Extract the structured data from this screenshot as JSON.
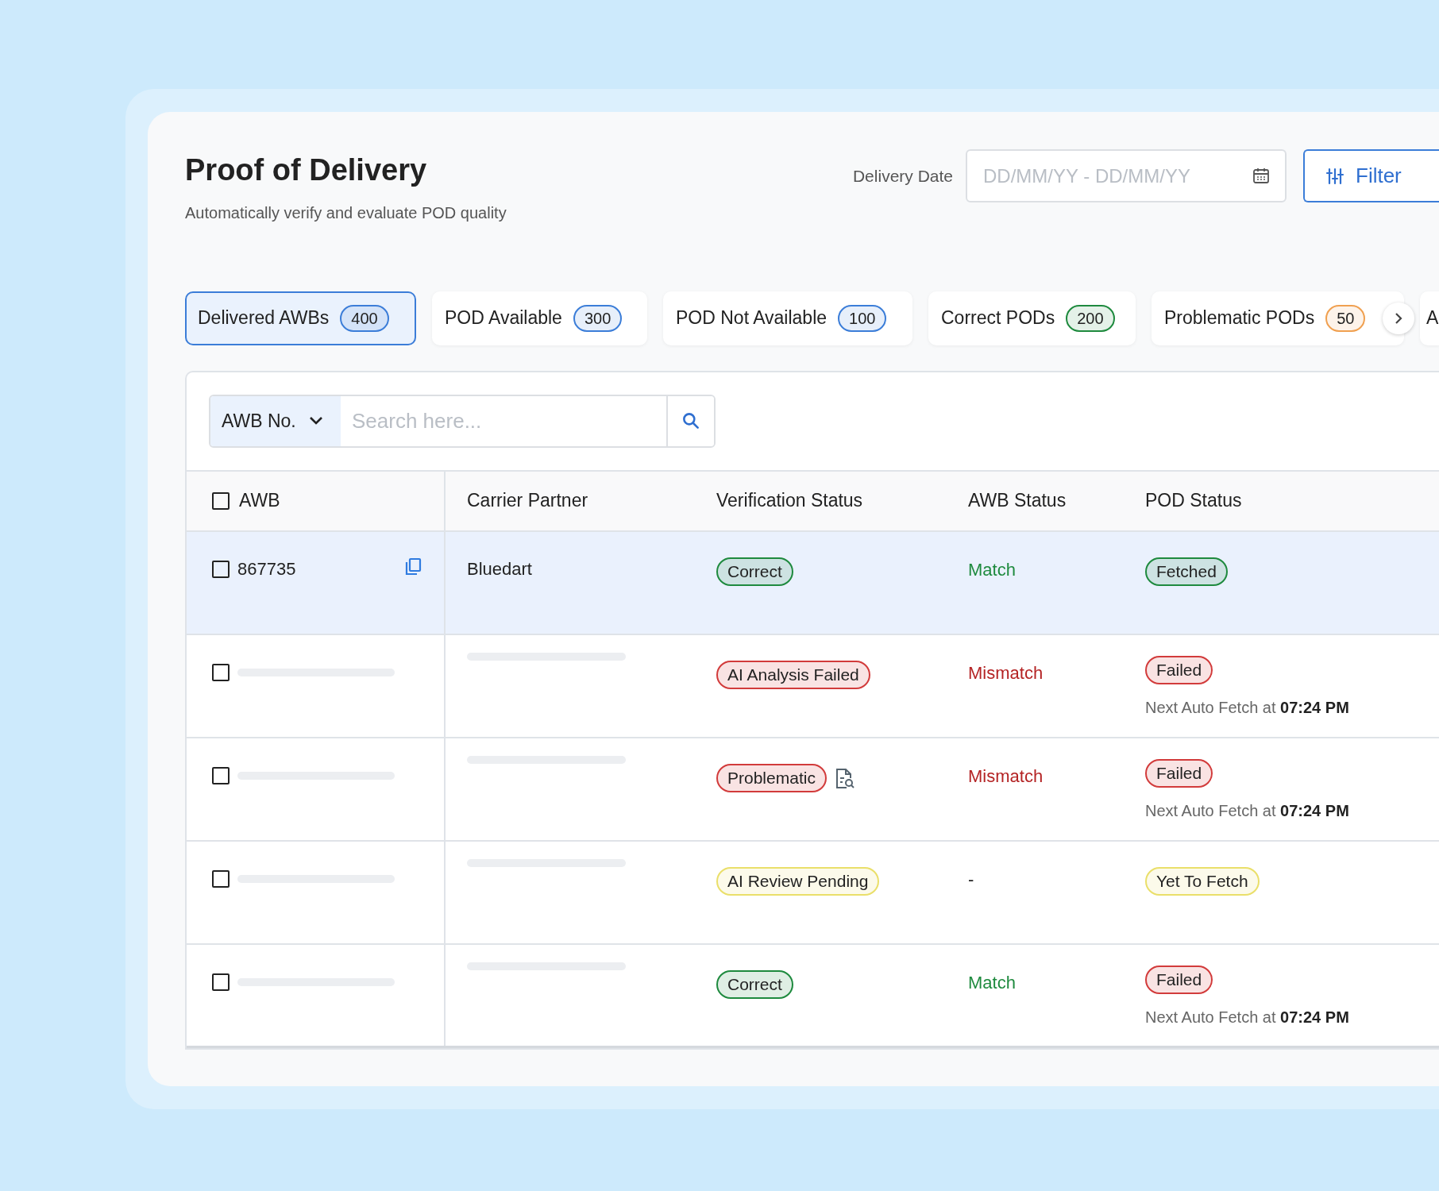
{
  "header": {
    "title": "Proof of Delivery",
    "subtitle": "Automatically verify and evaluate POD quality",
    "date_label": "Delivery Date",
    "date_field": {
      "placeholder": "DD/MM/YY - DD/MM/YY"
    },
    "filter_button": "Filter"
  },
  "tabs": [
    {
      "label": "Delivered AWBs",
      "count": "400",
      "color": "#3b7dd8",
      "selected": true
    },
    {
      "label": "POD Available",
      "count": "300",
      "color": "#3b7dd8",
      "selected": false
    },
    {
      "label": "POD Not Available",
      "count": "100",
      "color": "#3b7dd8",
      "selected": false
    },
    {
      "label": "Correct PODs",
      "count": "200",
      "color": "#1e8a3e",
      "selected": false
    },
    {
      "label": "Problematic PODs",
      "count": "50",
      "color": "#f0a050",
      "selected": false
    },
    {
      "label": "A",
      "selected": false
    }
  ],
  "search": {
    "field_selector": "AWB No.",
    "placeholder": "Search here..."
  },
  "table": {
    "columns": [
      "AWB",
      "Carrier Partner",
      "Verification Status",
      "AWB Status",
      "POD Status"
    ],
    "header_checked": false,
    "rows": [
      {
        "selected": true,
        "checked": false,
        "loading": false,
        "awb": "867735",
        "carrier": "Bluedart",
        "verification": {
          "label": "Correct",
          "color": "#1e8a3e",
          "review_icon": false
        },
        "awb_status": {
          "text": "Match",
          "color": "#1e8a3e"
        },
        "pod_status": {
          "label": "Fetched",
          "color": "#1e8a3e"
        }
      },
      {
        "selected": false,
        "checked": false,
        "loading": true,
        "verification": {
          "label": "AI Analysis Failed",
          "color": "#d23b3b",
          "review_icon": false
        },
        "awb_status": {
          "text": "Mismatch",
          "color": "#b42324"
        },
        "pod_status": {
          "label": "Failed",
          "color": "#d23b3b",
          "note": "Next Auto Fetch at **07:24 PM**"
        }
      },
      {
        "selected": false,
        "checked": false,
        "loading": true,
        "verification": {
          "label": "Problematic",
          "color": "#d23b3b",
          "review_icon": true
        },
        "awb_status": {
          "text": "Mismatch",
          "color": "#b42324"
        },
        "pod_status": {
          "label": "Failed",
          "color": "#d23b3b",
          "note": "Next Auto Fetch at **07:24 PM**"
        }
      },
      {
        "selected": false,
        "checked": false,
        "loading": true,
        "verification": {
          "label": "AI Review Pending",
          "color": "#eadf6a",
          "review_icon": false
        },
        "awb_status": {
          "text": "-",
          "color": "#222222"
        },
        "pod_status": {
          "label": "Yet To Fetch",
          "color": "#eadf6a"
        }
      },
      {
        "selected": false,
        "checked": false,
        "loading": true,
        "verification": {
          "label": "Correct",
          "color": "#1e8a3e",
          "review_icon": false
        },
        "awb_status": {
          "text": "Match",
          "color": "#1e8a3e"
        },
        "pod_status": {
          "label": "Failed",
          "color": "#d23b3b",
          "note": "Next Auto Fetch at **07:24 PM**"
        }
      }
    ]
  }
}
